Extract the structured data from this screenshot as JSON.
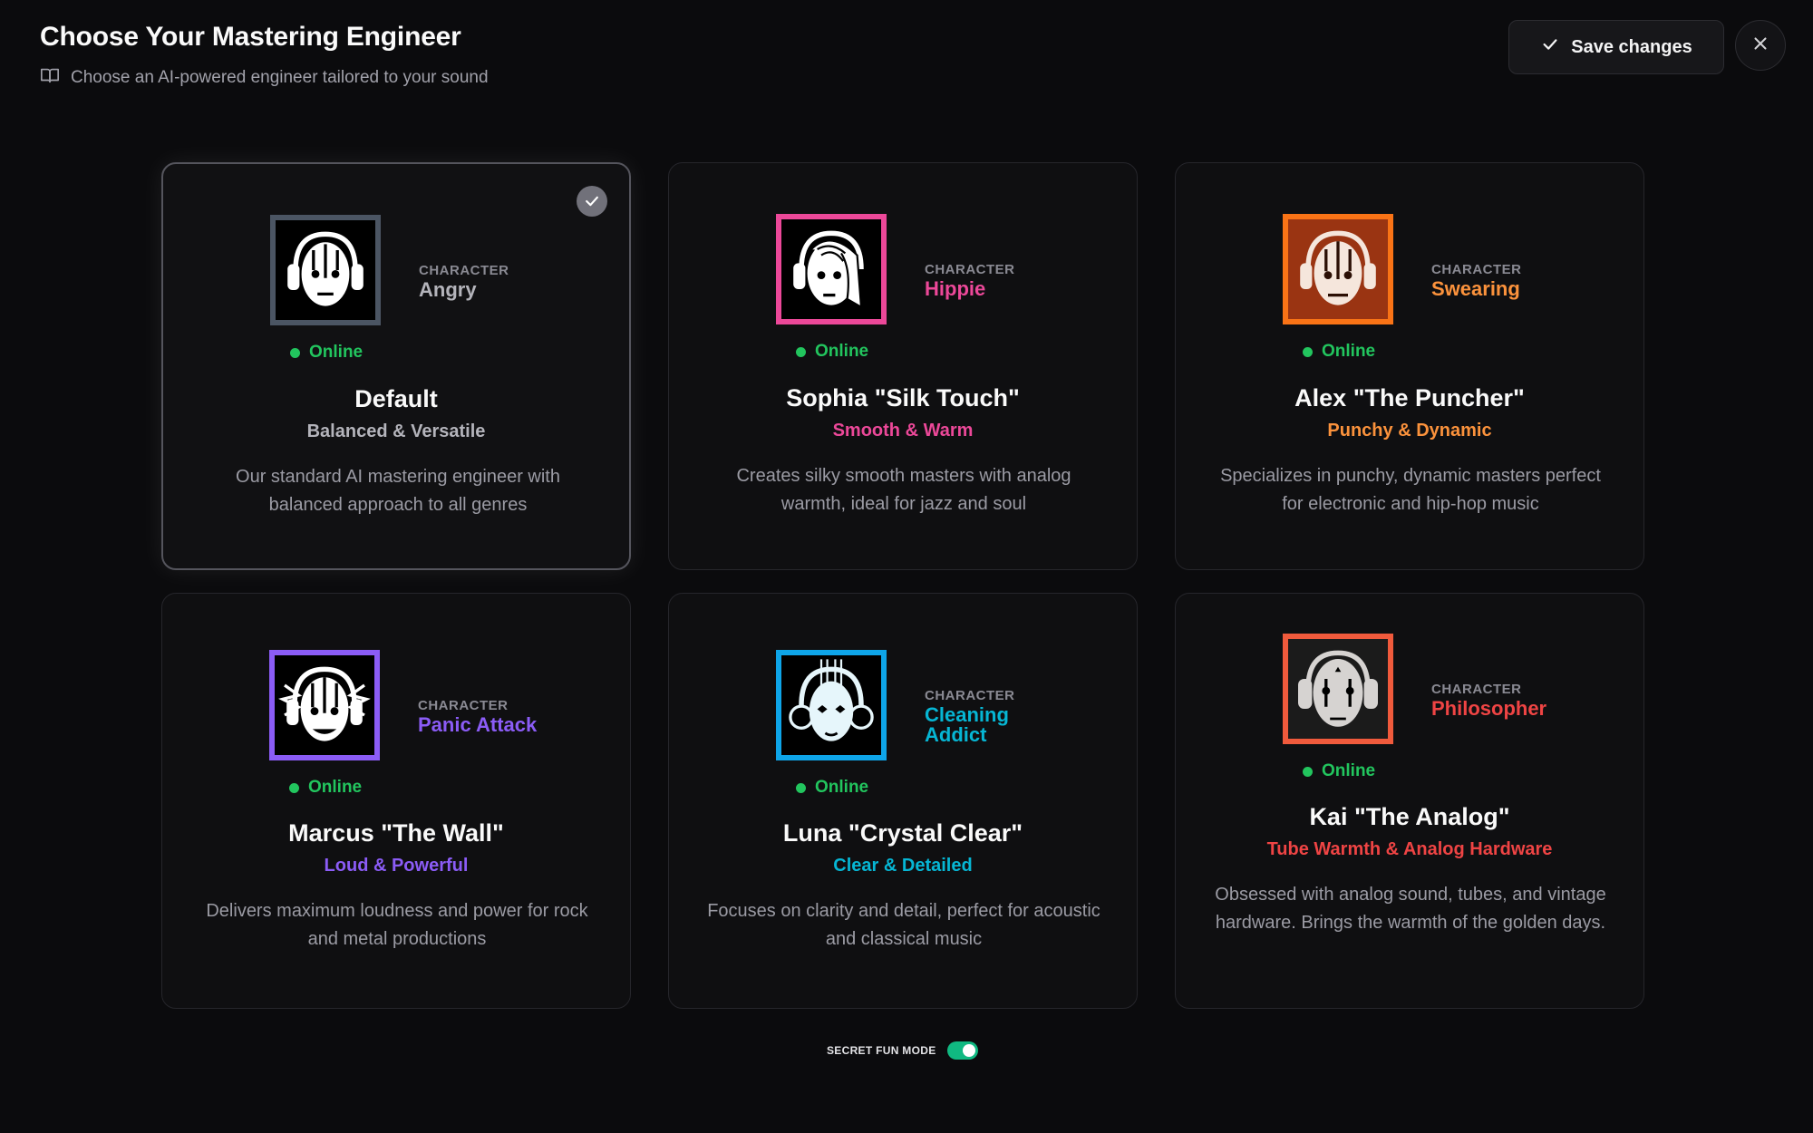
{
  "header": {
    "title": "Choose Your Mastering Engineer",
    "subtitle": "Choose an AI-powered engineer tailored to your sound",
    "subtitle_icon": "book-open-icon",
    "save_label": "Save changes",
    "save_icon": "check-icon",
    "close_icon": "close-icon"
  },
  "common": {
    "character_label": "CHARACTER",
    "online_label": "Online",
    "online_color": "#22c55e"
  },
  "engineers": [
    {
      "name": "Default",
      "tagline": "Balanced & Versatile",
      "character": "Angry",
      "description": "Our standard AI mastering engineer with balanced approach to all genres",
      "accent": "#b4b4bb",
      "frame": "#4b5563",
      "selected": true
    },
    {
      "name": "Sophia \"Silk Touch\"",
      "tagline": "Smooth & Warm",
      "character": "Hippie",
      "description": "Creates silky smooth masters with analog warmth, ideal for jazz and soul",
      "accent": "#ec4899",
      "frame": "#ec4899",
      "selected": false
    },
    {
      "name": "Alex \"The Puncher\"",
      "tagline": "Punchy & Dynamic",
      "character": "Swearing",
      "description": "Specializes in punchy, dynamic masters perfect for electronic and hip-hop music",
      "accent": "#fb923c",
      "frame": "#f97316",
      "selected": false
    },
    {
      "name": "Marcus \"The Wall\"",
      "tagline": "Loud & Powerful",
      "character": "Panic Attack",
      "description": "Delivers maximum loudness and power for rock and metal productions",
      "accent": "#8b5cf6",
      "frame": "#8b5cf6",
      "selected": false
    },
    {
      "name": "Luna \"Crystal Clear\"",
      "tagline": "Clear & Detailed",
      "character": "Cleaning Addict",
      "description": "Focuses on clarity and detail, perfect for acoustic and classical music",
      "accent": "#06b6d4",
      "frame": "#0ea5e9",
      "selected": false
    },
    {
      "name": "Kai \"The Analog\"",
      "tagline": "Tube Warmth & Analog Hardware",
      "character": "Philosopher",
      "description": "Obsessed with analog sound, tubes, and vintage hardware. Brings the warmth of the golden days.",
      "accent": "#ef4444",
      "frame": "#f05a3c",
      "selected": false
    }
  ],
  "footer": {
    "fun_mode_label": "SECRET FUN MODE",
    "fun_mode_on": true,
    "toggle_color": "#10b981"
  }
}
